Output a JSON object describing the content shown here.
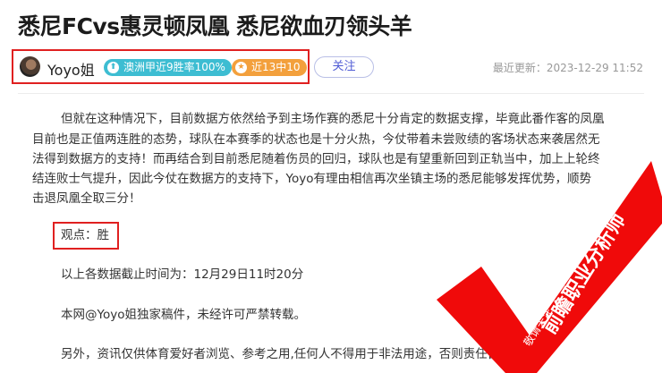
{
  "article": {
    "title": "悉尼FCvs惠灵顿凤凰 悉尼欲血刃领头羊",
    "updated": "最近更新：2023-12-29 11:52"
  },
  "author": {
    "name": "Yoyo姐",
    "badge_streak": "澳洲甲近9胜率100%",
    "badge_recent": "近13中10",
    "follow_label": "关注"
  },
  "body": {
    "para1_line1": "但就在这种情况下，目前数据方依然给予到主场作赛的悉尼十分肯定的数据支撑，毕竟此番作客的凤凰",
    "para1_line2": "目前也是正值两连胜的态势，球队在本赛季的状态也是十分火热，今仗带着未尝败绩的客场状态来袭居然无",
    "para1_line3": "法得到数据方的支持！而再结合到目前悉尼随着伤员的回归，球队也是有望重新回到正轨当中，加上上轮终",
    "para1_line4": "结连败士气提升，因此今仗在数据方的支持下，Yoyo有理由相信再次坐镇主场的悉尼能够发挥优势，顺势",
    "para1_line5": "击退凤凰全取三分！",
    "opinion": "观点：胜",
    "cutoff": "以上各数据截止时间为：12月29日11时20分",
    "copyright": "本网@Yoyo姐独家稿件，未经许可严禁转载。",
    "disclaimer": "另外，资讯仅供体育爱好者浏览、参考之用,任何人不得用于非法用途，否则责任自负"
  },
  "stamp": {
    "text_large": "前瞻职业分析师",
    "text_small": "敬请关注",
    "color": "#f00a0a"
  }
}
